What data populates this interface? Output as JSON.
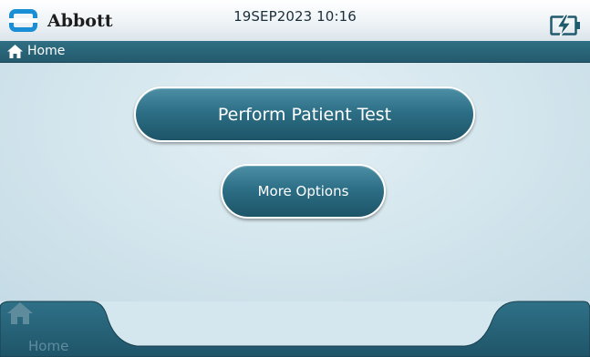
{
  "header": {
    "brand": "Abbott",
    "datetime": "19SEP2023 10:16",
    "battery_icon": "battery-charging-icon"
  },
  "breadcrumb": {
    "icon": "home-icon",
    "label": "Home"
  },
  "main": {
    "primary_button": "Perform Patient Test",
    "secondary_button": "More Options"
  },
  "bottom_nav": {
    "home_label": "Home",
    "home_icon": "home-icon"
  },
  "colors": {
    "brand_blue": "#1a8fd6",
    "bar_teal": "#2a6a7f",
    "button_teal": "#2d6f86",
    "background": "#d4e6ee"
  }
}
